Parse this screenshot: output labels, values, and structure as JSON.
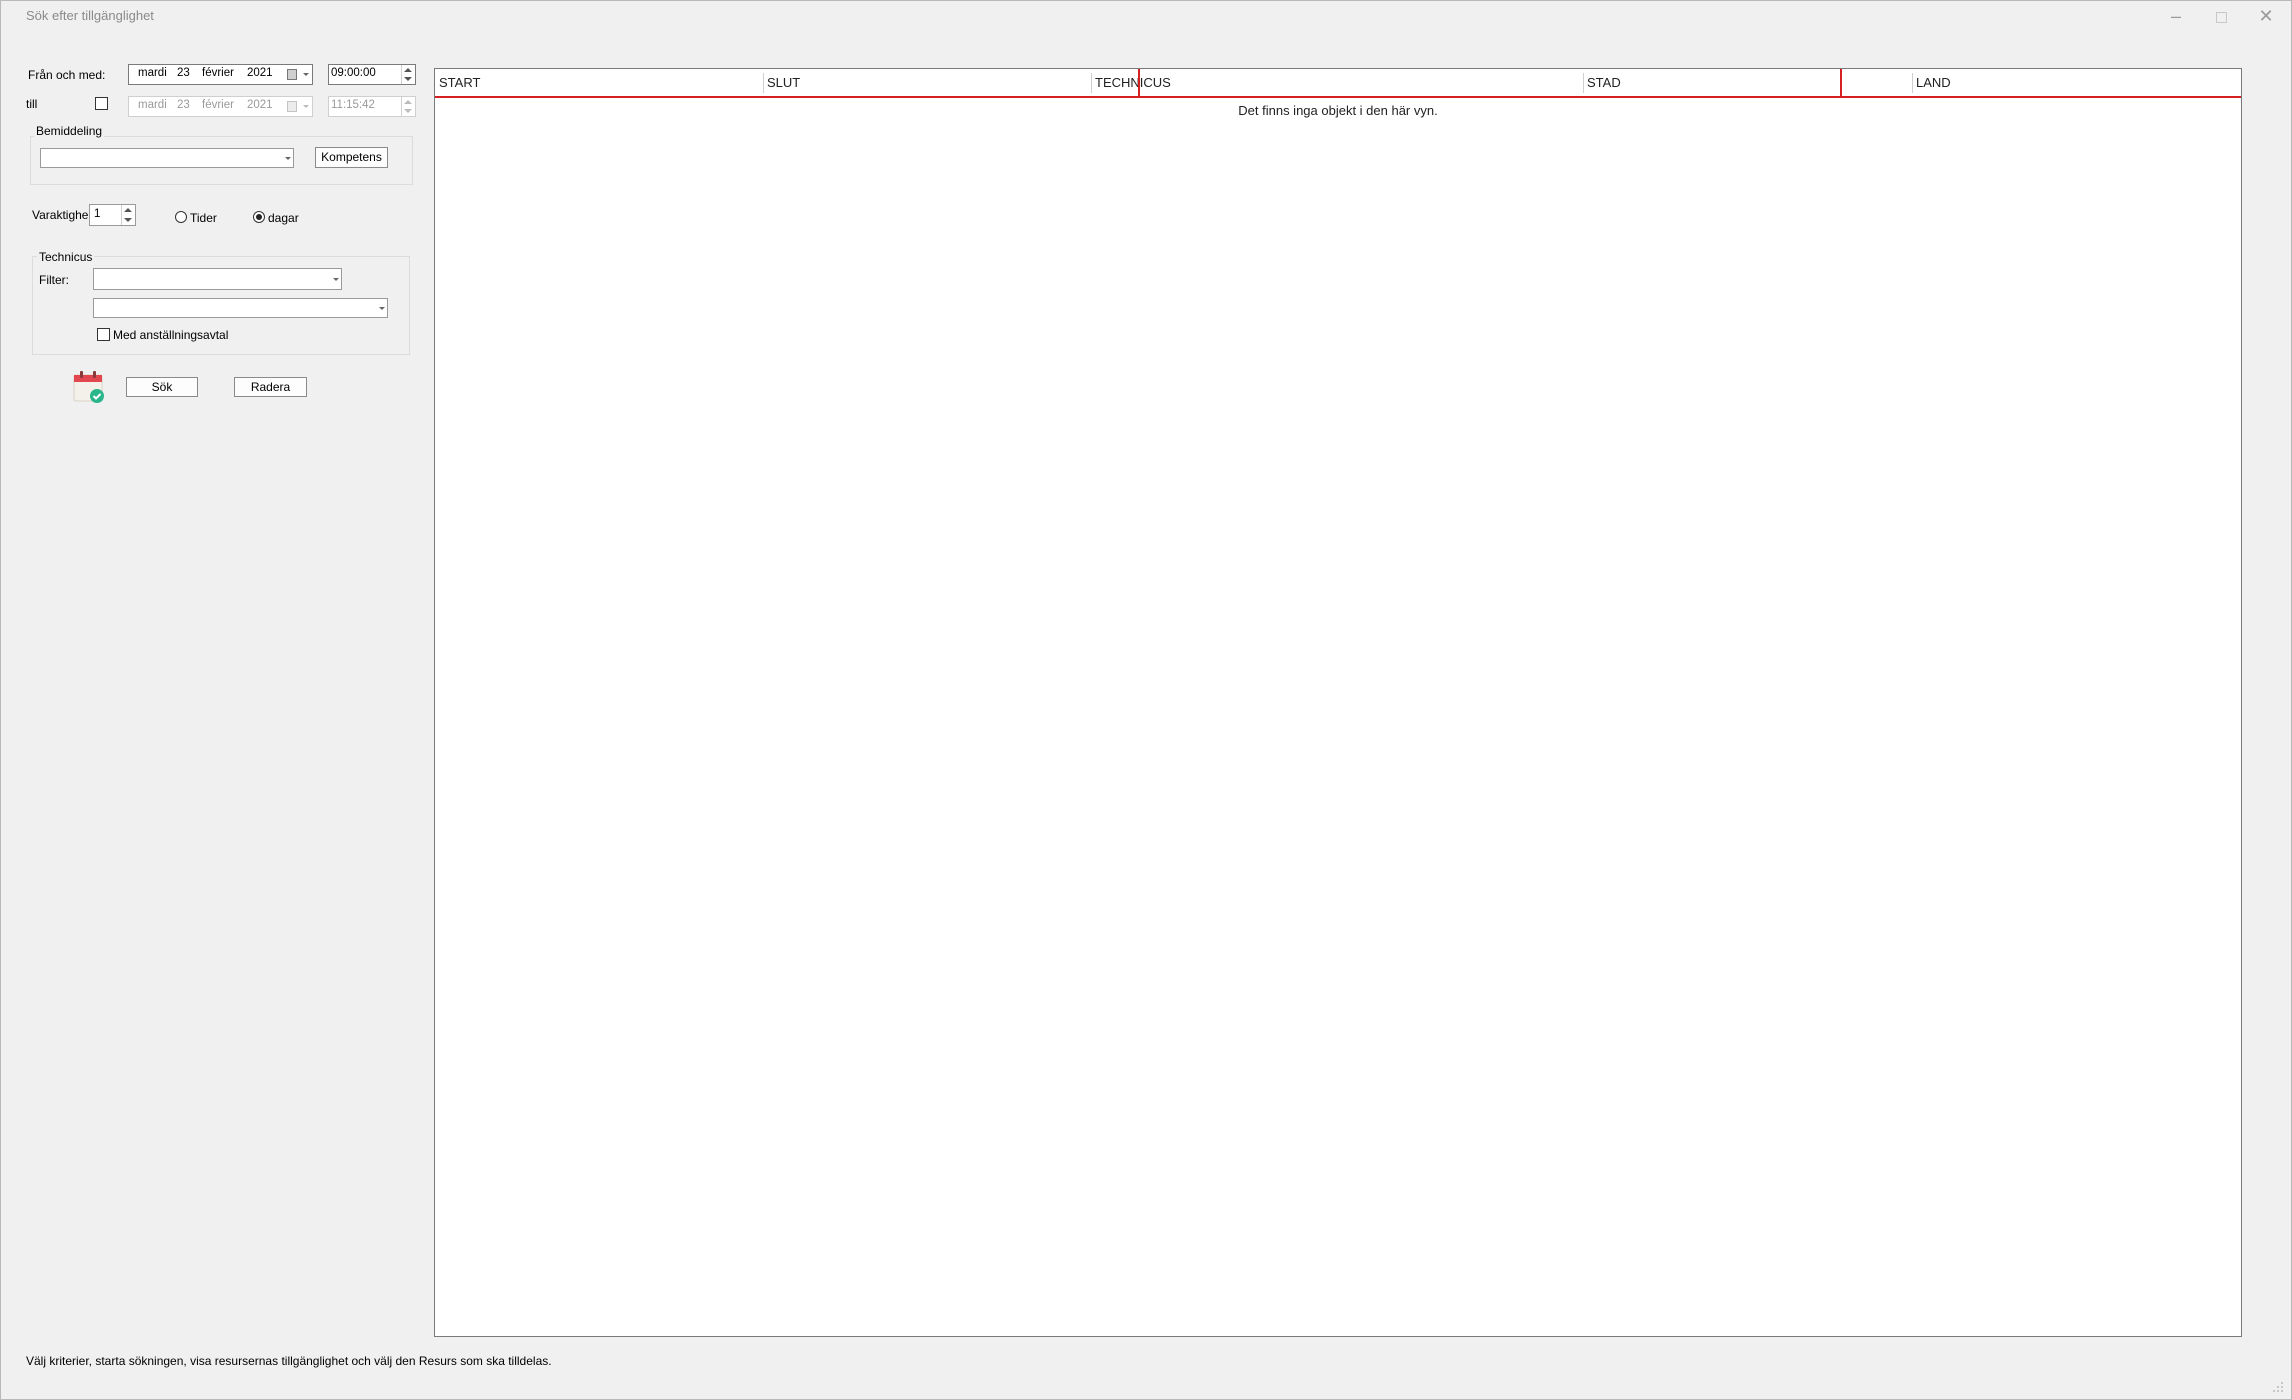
{
  "window": {
    "title": "Sök efter tillgänglighet"
  },
  "from": {
    "label": "Från och med:",
    "date": {
      "weekday": "mardi",
      "day": "23",
      "month": "février",
      "year": "2021"
    },
    "time": "09:00:00"
  },
  "to": {
    "label": "till",
    "checked": false,
    "date": {
      "weekday": "mardi",
      "day": "23",
      "month": "février",
      "year": "2021"
    },
    "time": "11:15:42"
  },
  "mediation": {
    "label": "Bemiddeling",
    "selected": "",
    "button": "Kompetens"
  },
  "duration": {
    "label": "Varaktighe",
    "value": "1",
    "option_times": "Tider",
    "option_days": "dagar",
    "selected": "dagar"
  },
  "technicus": {
    "label": "Technicus",
    "filter_label": "Filter:",
    "filter_value": "",
    "second_value": "",
    "checkbox_label": "Med anställningsavtal",
    "checkbox_checked": false
  },
  "actions": {
    "icon": "calendar-check-icon",
    "search": "Sök",
    "clear": "Radera"
  },
  "grid": {
    "columns": [
      "START",
      "SLUT",
      "TECHNICUS",
      "STAD",
      "",
      "LAND"
    ],
    "empty_message": "Det finns inga objekt i den här vyn."
  },
  "status": "Välj kriterier, starta sökningen, visa resursernas tillgänglighet och välj den Resurs som ska tilldelas.",
  "colors": {
    "accent": "#d42020",
    "background": "#f0f0f0"
  }
}
